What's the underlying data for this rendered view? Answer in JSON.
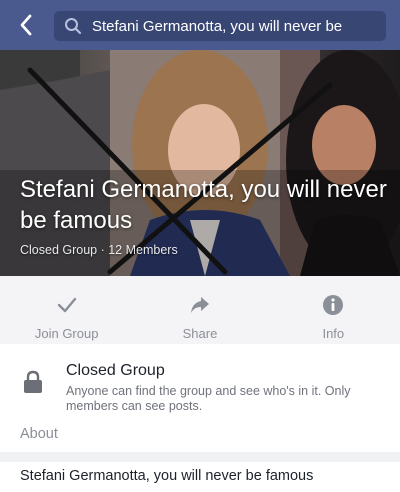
{
  "header": {
    "search_query": "Stefani Germanotta, you will never be",
    "bar_color": "#4a5a8f",
    "search_bg_color": "#384674"
  },
  "cover": {
    "title": "Stefani Germanotta, you will never be famous",
    "meta": "Closed Group · 12 Members"
  },
  "actions": [
    {
      "label": "Join Group",
      "icon": "checkmark-icon"
    },
    {
      "label": "Share",
      "icon": "share-arrow-icon"
    },
    {
      "label": "Info",
      "icon": "info-icon"
    }
  ],
  "privacy": {
    "icon": "lock-icon",
    "title": "Closed Group",
    "description": "Anyone can find the group and see who's in it. Only members can see posts."
  },
  "about": {
    "label": "About",
    "text": "Stefani Germanotta, you will never be famous"
  }
}
